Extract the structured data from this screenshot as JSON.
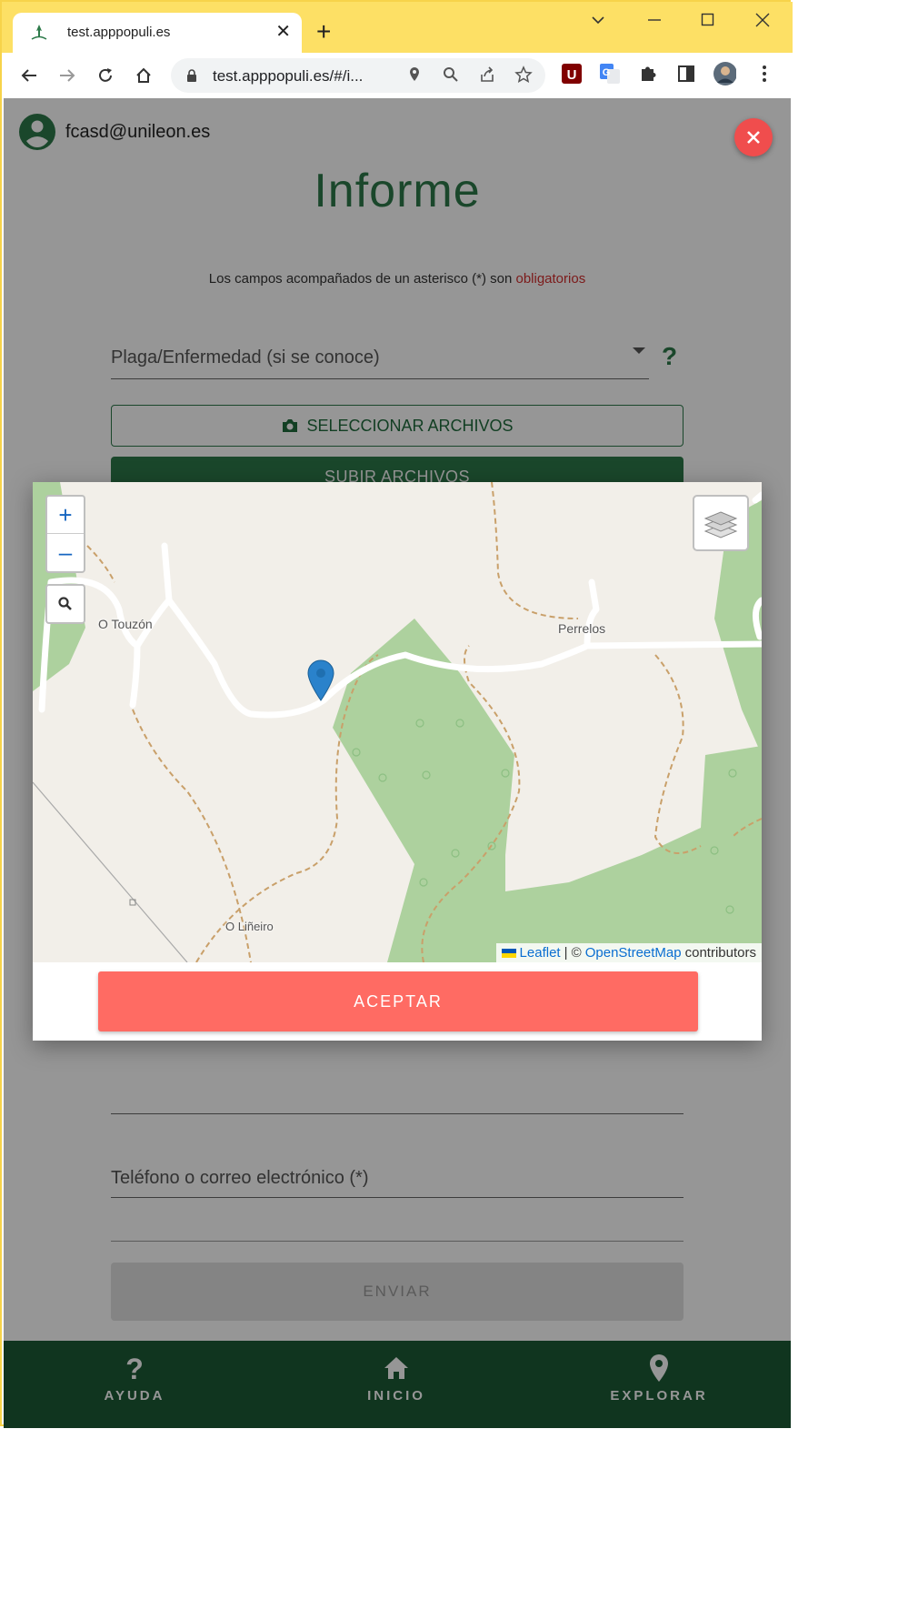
{
  "browser": {
    "tab_title": "test.apppopuli.es",
    "tab_close": "✕",
    "new_tab": "+",
    "url": "test.apppopuli.es/#/i..."
  },
  "user": {
    "email": "fcasd@unileon.es"
  },
  "page": {
    "title": "Informe",
    "required_note_prefix": "Los campos acompañados de un asterisco (*) son ",
    "required_note_emph": "obligatorios",
    "pest_field_label": "Plaga/Enfermedad (si se conoce)",
    "help_symbol": "?",
    "select_files_label": "SELECCIONAR ARCHIVOS",
    "upload_files_label": "SUBIR ARCHIVOS",
    "contact_field_label": "Teléfono o correo electrónico (*)",
    "send_label": "ENVIAR"
  },
  "map": {
    "zoom_in": "+",
    "zoom_out": "–",
    "places": {
      "touzon": "O Touzón",
      "perrelos": "Perrelos",
      "lineiro": "O Liñeiro"
    },
    "attribution": {
      "leaflet": "Leaflet",
      "separator": "| ©",
      "osm": "OpenStreetMap",
      "contributors": "contributors"
    }
  },
  "modal": {
    "accept_label": "ACEPTAR"
  },
  "bottom_nav": {
    "help": "AYUDA",
    "home": "INICIO",
    "explore": "EXPLORAR"
  },
  "colors": {
    "brand_green": "#2d7a4a",
    "nav_green": "#1c5b36",
    "accept_red": "#ff6b63",
    "close_red": "#f04d4d"
  }
}
